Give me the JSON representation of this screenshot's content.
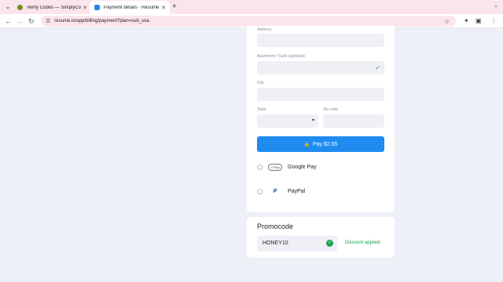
{
  "browser": {
    "tabs": [
      {
        "title": "Verify Codes — SimplyCodes",
        "active": false
      },
      {
        "title": "Payment details · Resume.io",
        "active": true
      }
    ],
    "url": "resume.io/app/billing/payment?plan=sub_usa"
  },
  "form": {
    "address_label": "Address",
    "apartment_label": "Apartment / Suite (optional)",
    "city_label": "City",
    "state_label": "State",
    "zip_label": "Zip code"
  },
  "payment": {
    "pay_button": "Pay $2.65",
    "options": [
      {
        "name": "Google Pay",
        "logo": "G Pay"
      },
      {
        "name": "PayPal",
        "logo": "P"
      }
    ]
  },
  "promo": {
    "title": "Promocode",
    "code": "HONEY10",
    "status": "Discount applied"
  },
  "colors": {
    "accent": "#1f8bf0",
    "success": "#1aa052",
    "page_bg": "#eef0f8"
  }
}
